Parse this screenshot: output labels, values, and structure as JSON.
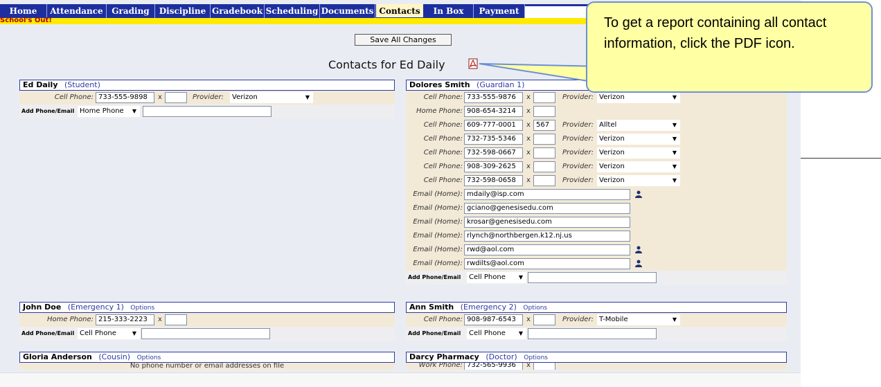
{
  "nav": {
    "items": [
      {
        "label": "Home",
        "width": 68
      },
      {
        "label": "Attendance",
        "width": 86
      },
      {
        "label": "Grading",
        "width": 70
      },
      {
        "label": "Discipline",
        "width": 80
      },
      {
        "label": "Gradebook",
        "width": 78
      },
      {
        "label": "Scheduling",
        "width": 80
      },
      {
        "label": "Documents",
        "width": 80
      },
      {
        "label": "Contacts",
        "width": 70
      },
      {
        "label": "In Box",
        "width": 72
      },
      {
        "label": "Payment",
        "width": 74
      }
    ],
    "active": "Contacts"
  },
  "status_text": "School's Out!",
  "save_label": "Save All Changes",
  "page_title": "Contacts for Ed Daily",
  "callout_text": "To get a report containing all contact information, click the PDF icon.",
  "student": {
    "name": "Ed Daily",
    "role": "(Student)",
    "phone_label": "Cell Phone:",
    "phone": "733-555-9898",
    "ext": "",
    "provider_label": "Provider:",
    "provider": "Verizon",
    "add_label": "Add Phone/Email",
    "add_select": "Home Phone"
  },
  "guardian": {
    "name": "Dolores Smith",
    "role": "(Guardian 1)",
    "phones": [
      {
        "label": "Cell Phone:",
        "number": "733-555-9876",
        "ext": "",
        "provider": "Verizon"
      },
      {
        "label": "Home Phone:",
        "number": "908-654-3214",
        "ext": "",
        "provider": ""
      },
      {
        "label": "Cell Phone:",
        "number": "609-777-0001",
        "ext": "567",
        "provider": "Alltel"
      },
      {
        "label": "Cell Phone:",
        "number": "732-735-5346",
        "ext": "",
        "provider": "Verizon"
      },
      {
        "label": "Cell Phone:",
        "number": "732-598-0667",
        "ext": "",
        "provider": "Verizon"
      },
      {
        "label": "Cell Phone:",
        "number": "908-309-2625",
        "ext": "",
        "provider": "Verizon"
      },
      {
        "label": "Cell Phone:",
        "number": "732-598-0658",
        "ext": "",
        "provider": "Verizon"
      }
    ],
    "emails": [
      {
        "label": "Email (Home):",
        "address": "mdaily@isp.com",
        "icon": true
      },
      {
        "label": "Email (Home):",
        "address": "gciano@genesisedu.com",
        "icon": false
      },
      {
        "label": "Email (Home):",
        "address": "krosar@genesisedu.com",
        "icon": false
      },
      {
        "label": "Email (Home):",
        "address": "rlynch@northbergen.k12.nj.us",
        "icon": false
      },
      {
        "label": "Email (Home):",
        "address": "rwd@aol.com",
        "icon": true
      },
      {
        "label": "Email (Home):",
        "address": "rwdilts@aol.com",
        "icon": true
      }
    ],
    "provider_label": "Provider:",
    "add_label": "Add Phone/Email",
    "add_select": "Cell Phone"
  },
  "emergency1": {
    "name": "John Doe",
    "role": "(Emergency 1)",
    "options": "Options",
    "phone_label": "Home Phone:",
    "phone": "215-333-2223",
    "ext": "",
    "add_label": "Add Phone/Email",
    "add_select": "Cell Phone"
  },
  "emergency2": {
    "name": "Ann Smith",
    "role": "(Emergency 2)",
    "options": "Options",
    "phone_label": "Cell Phone:",
    "phone": "908-987-6543",
    "ext": "",
    "provider_label": "Provider:",
    "provider": "T-Mobile",
    "add_label": "Add Phone/Email",
    "add_select": "Cell Phone"
  },
  "cousin": {
    "name": "Gloria Anderson",
    "role": "(Cousin)",
    "options": "Options",
    "no_contact": "No phone number or email addresses on file"
  },
  "doctor": {
    "name": "Darcy Pharmacy",
    "role": "(Doctor)",
    "options": "Options",
    "phone_label": "Work Phone:",
    "phone": "732-565-9936",
    "ext": ""
  },
  "colors": {
    "nav_bg": "#1d2f9e",
    "status_bg": "#ffea00",
    "panel_bg": "#f3e9d7",
    "callout_bg": "#ffffa3",
    "callout_border": "#6c8fd8"
  }
}
